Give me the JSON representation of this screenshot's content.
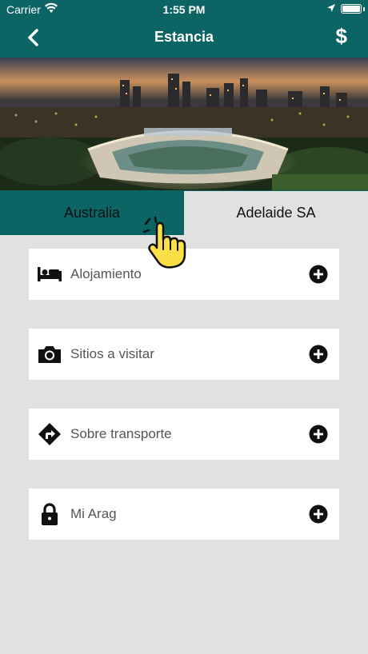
{
  "status": {
    "carrier": "Carrier",
    "time": "1:55 PM"
  },
  "nav": {
    "title": "Estancia",
    "dollar": "$"
  },
  "tabs": {
    "active": "Australia",
    "inactive": "Adelaide SA"
  },
  "menu": [
    {
      "label": "Alojamiento",
      "icon": "bed-icon"
    },
    {
      "label": "Sitios a visitar",
      "icon": "camera-icon"
    },
    {
      "label": "Sobre transporte",
      "icon": "directions-icon"
    },
    {
      "label": "Mi Arag",
      "icon": "lock-icon"
    }
  ],
  "colors": {
    "primary": "#0c6465",
    "background": "#e1e1e1",
    "card": "#ffffff"
  }
}
